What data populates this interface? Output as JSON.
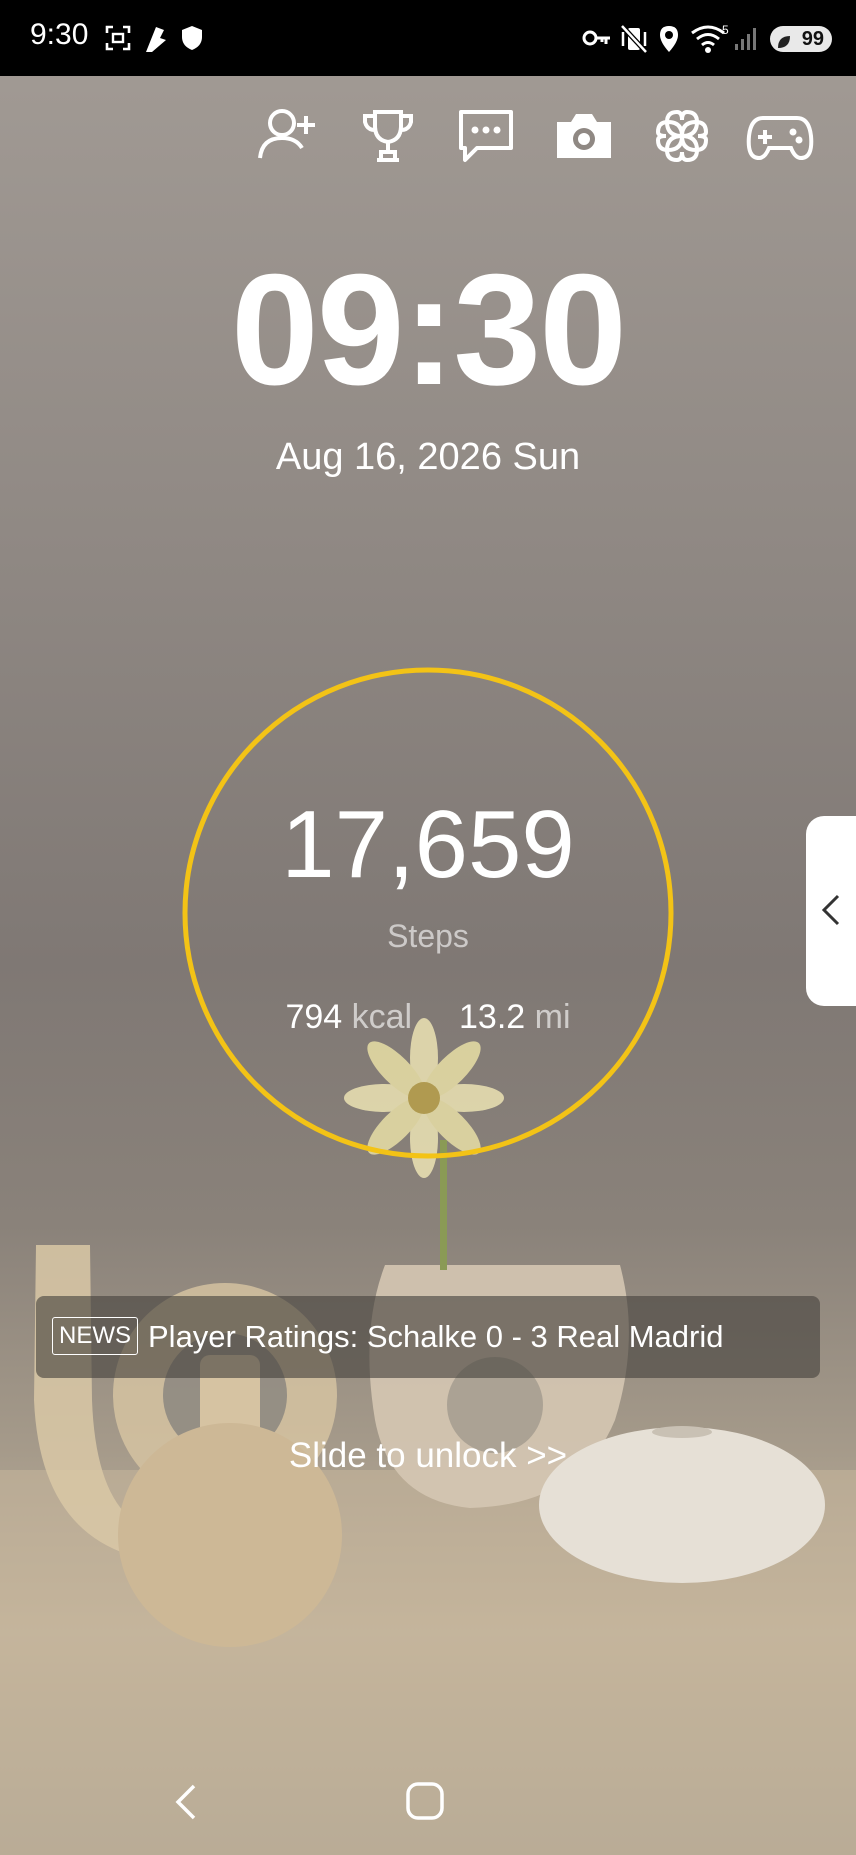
{
  "status_bar": {
    "time": "9:30",
    "network_label": "5",
    "battery_level": "99",
    "icons": [
      "screenshot-icon",
      "flag-icon",
      "shield-icon",
      "vpn-key-icon",
      "vibrate-mute-icon",
      "location-icon",
      "wifi-icon",
      "cell-signal-icon",
      "battery-saver-icon"
    ]
  },
  "shortcuts": [
    "add-friend-icon",
    "trophy-icon",
    "message-icon",
    "camera-icon",
    "clover-icon",
    "gamepad-icon"
  ],
  "clock": {
    "time": "09:30",
    "date": "Aug 16, 2026 Sun"
  },
  "steps": {
    "value": "17,659",
    "label": "Steps",
    "calories_value": "794",
    "calories_unit": "kcal",
    "distance_value": "13.2",
    "distance_unit": "mi",
    "ring_color": "#f3c316"
  },
  "news": {
    "tag": "NEWS",
    "headline": "Player Ratings: Schalke 0 - 3 Real Madrid"
  },
  "unlock": {
    "label": "Slide to unlock >>"
  },
  "nav": [
    "back-icon",
    "home-icon"
  ]
}
